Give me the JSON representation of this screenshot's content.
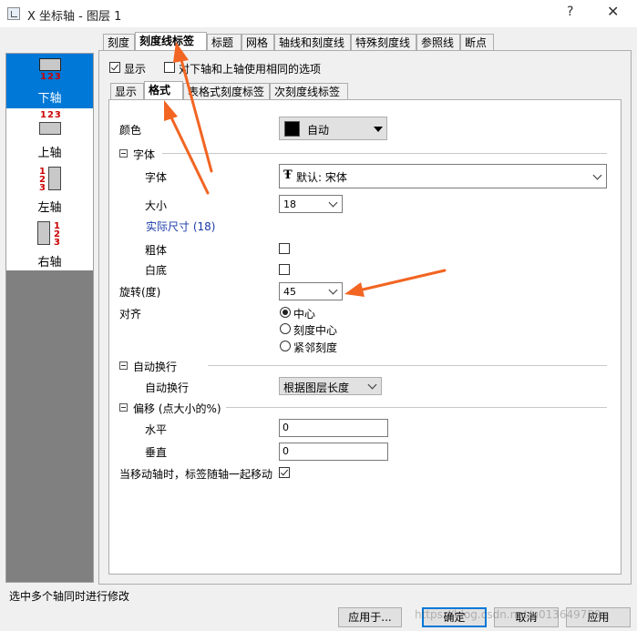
{
  "window": {
    "title": "X 坐标轴 - 图层 1",
    "help_glyph": "?",
    "close_glyph": "✕"
  },
  "axes": [
    {
      "label": "下轴",
      "nums": "123"
    },
    {
      "label": "上轴",
      "nums": "123"
    },
    {
      "label": "左轴",
      "nums": "123"
    },
    {
      "label": "右轴",
      "nums": "123"
    }
  ],
  "top_tabs": [
    "刻度",
    "刻度线标签",
    "标题",
    "网格",
    "轴线和刻度线",
    "特殊刻度线",
    "参照线",
    "断点"
  ],
  "show_checkbox": {
    "label": "显示",
    "checked": true
  },
  "same_options_checkbox": {
    "label": "对下轴和上轴使用相同的选项",
    "checked": false
  },
  "inner_tabs": [
    "显示",
    "格式",
    "表格式刻度标签",
    "次刻度线标签"
  ],
  "format": {
    "color_label": "颜色",
    "color_value": "自动",
    "color_swatch": "#000000",
    "font_group": "字体",
    "font_label": "字体",
    "font_value": "默认: 宋体",
    "size_label": "大小",
    "size_value": "18",
    "actual_size": "实际尺寸 (18)",
    "bold_label": "粗体",
    "bold_checked": false,
    "white_bg_label": "白底",
    "white_bg_checked": false,
    "rotation_label": "旋转(度)",
    "rotation_value": "45",
    "align_label": "对齐",
    "align_options": [
      "中心",
      "刻度中心",
      "紧邻刻度"
    ],
    "align_selected": 0,
    "wrap_group": "自动换行",
    "wrap_label": "自动换行",
    "wrap_value": "根据图层长度",
    "offset_group": "偏移 (点大小的%)",
    "horizontal_label": "水平",
    "horizontal_value": "0",
    "vertical_label": "垂直",
    "vertical_value": "0",
    "move_with_axis_label": "当移动轴时，标签随轴一起移动",
    "move_with_axis_checked": true
  },
  "status_text": "选中多个轴同时进行修改",
  "buttons": {
    "apply": "应用于...",
    "ok": "确定",
    "cancel": "取消",
    "apply2": "应用"
  },
  "watermark": "https://blog.csdn.net/u013649759",
  "accent_color": "#0078d7",
  "arrow_color": "#f26522"
}
